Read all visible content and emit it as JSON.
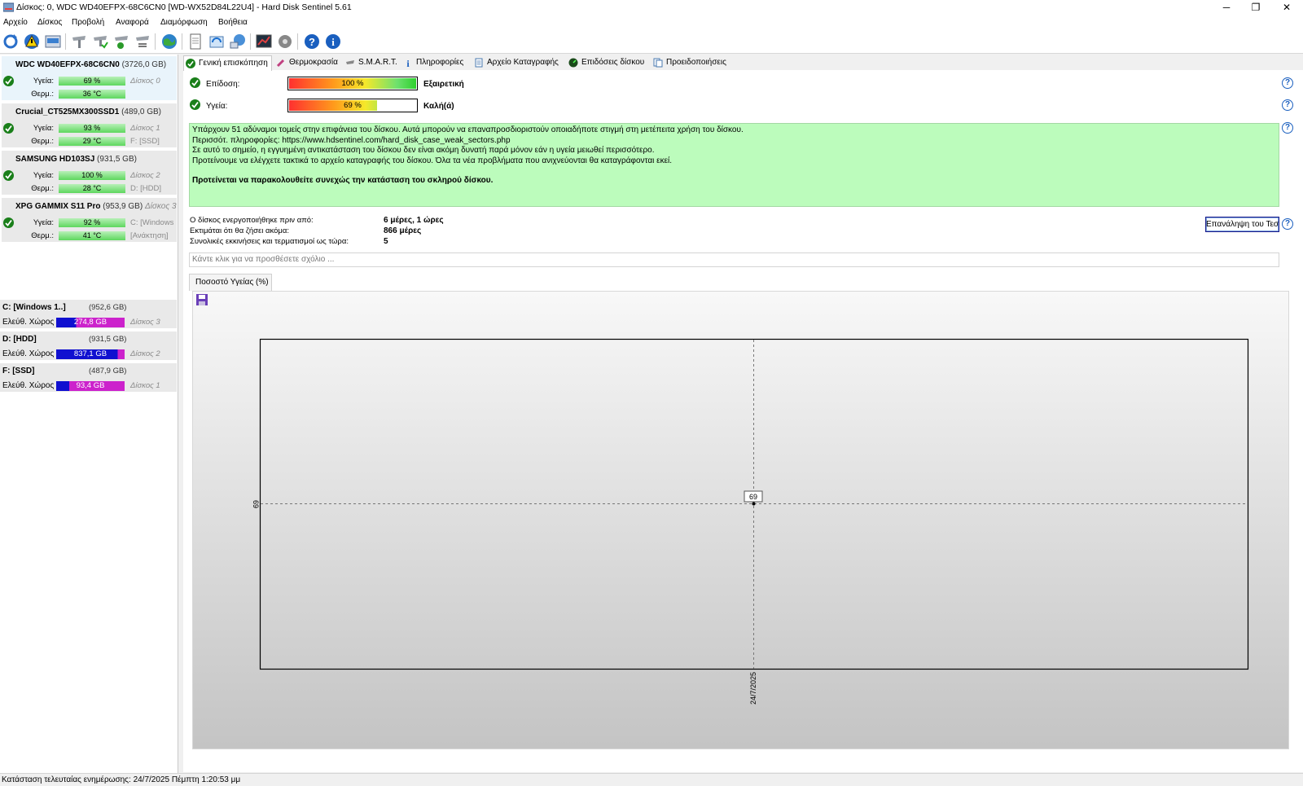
{
  "window": {
    "title": "Δίσκος: 0, WDC WD40EFPX-68C6CN0 [WD-WX52D84L22U4]  -  Hard Disk Sentinel 5.61",
    "minimize": "─",
    "maximize": "❐",
    "close": "✕"
  },
  "menu": [
    "Αρχείο",
    "Δίσκος",
    "Προβολή",
    "Αναφορά",
    "Διαμόρφωση",
    "Βοήθεια"
  ],
  "disks": [
    {
      "name": "WDC WD40EFPX-68C6CN0",
      "size": "(3726,0 GB)",
      "health_label": "Υγεία:",
      "health": "69 %",
      "temp_label": "Θερμ.:",
      "temp": "36 °C",
      "disk_no": "Δίσκος 0",
      "volume": ""
    },
    {
      "name": "Crucial_CT525MX300SSD1",
      "size": "(489,0 GB)",
      "health_label": "Υγεία:",
      "health": "93 %",
      "temp_label": "Θερμ.:",
      "temp": "29 °C",
      "disk_no": "Δίσκος 1",
      "volume": "F: [SSD]"
    },
    {
      "name": "SAMSUNG HD103SJ",
      "size": "(931,5 GB)",
      "health_label": "Υγεία:",
      "health": "100 %",
      "temp_label": "Θερμ.:",
      "temp": "28 °C",
      "disk_no": "Δίσκος 2",
      "volume": "D: [HDD]"
    },
    {
      "name": "XPG GAMMIX S11 Pro",
      "size": "(953,9 GB)",
      "health_label": "Υγεία:",
      "health": "92 %",
      "temp_label": "Θερμ.:",
      "temp": "41 °C",
      "disk_no": "Δίσκος 3",
      "volume": "C: [Windows",
      "volume2": "[Ανάκτηση]"
    }
  ],
  "volumes": [
    {
      "name": "C: [Windows 1..]",
      "size": "(952,6 GB)",
      "free_label": "Ελεύθ. Χώρος",
      "free": "274,8 GB",
      "free_fraction": 0.29,
      "disk": "Δίσκος 3"
    },
    {
      "name": "D: [HDD]",
      "size": "(931,5 GB)",
      "free_label": "Ελεύθ. Χώρος",
      "free": "837,1 GB",
      "free_fraction": 0.9,
      "disk": "Δίσκος 2"
    },
    {
      "name": "F: [SSD]",
      "size": "(487,9 GB)",
      "free_label": "Ελεύθ. Χώρος",
      "free": "93,4 GB",
      "free_fraction": 0.19,
      "disk": "Δίσκος 1"
    }
  ],
  "tabs": [
    "Γενική επισκόπηση",
    "Θερμοκρασία",
    "S.M.A.R.T.",
    "Πληροφορίες",
    "Αρχείο Καταγραφής",
    "Επιδόσεις δίσκου",
    "Προειδοποιήσεις"
  ],
  "overview": {
    "performance_label": "Επίδοση:",
    "performance_value": "100 %",
    "performance_fraction": 1.0,
    "performance_rating": "Εξαιρετική",
    "health_label": "Υγεία:",
    "health_value": "69 %",
    "health_fraction": 0.69,
    "health_rating": "Καλή(ά)",
    "message": [
      "Υπάρχουν 51 αδύναμοι τομείς στην επιφάνεια του δίσκου. Αυτά μπορούν να επαναπροσδιοριστούν οποιαδήποτε στιγμή στη μετέπειτα χρήση του δίσκου.",
      "Περισσότ. πληροφορίες:  https://www.hdsentinel.com/hard_disk_case_weak_sectors.php",
      "Σε αυτό το σημείο, η εγγυημένη αντικατάσταση του δίσκου δεν είναι ακόμη δυνατή παρά μόνον εάν η υγεία μειωθεί περισσότερο.",
      "Προτείνουμε να ελέγχετε τακτικά το αρχείο καταγραφής του δίσκου. Όλα τα νέα προβλήματα που ανιχνεύονται θα καταγράφονται εκεί."
    ],
    "message_bold": "Προτείνεται να παρακολουθείτε συνεχώς την κατάσταση του σκληρού δίσκου.",
    "powered_on_label": "Ο δίσκος ενεργοποιήθηκε πριν από:",
    "powered_on_value": "6 μέρες, 1 ώρες",
    "remaining_label": "Εκτιμάται ότι θα ζήσει ακόμα:",
    "remaining_value": "866 μέρες",
    "starts_label": "Συνολικές εκκινήσεις και τερματισμοί ως τώρα:",
    "starts_value": "5",
    "retest_button": "Επανάληψη του Τεστ",
    "comment_placeholder": "Κάντε κλικ για να προσθέσετε σχόλιο ..."
  },
  "chart_tab": "Ποσοστό Υγείας (%)",
  "chart_data": {
    "type": "line",
    "x": [
      "24/7/2025"
    ],
    "series": [
      {
        "values": [
          69
        ]
      }
    ],
    "data_labels": [
      "69"
    ],
    "ytick_labels": [
      "69"
    ],
    "xtick_labels": [
      "24/7/2025"
    ],
    "grid": true
  },
  "status": "Κατάσταση τελευταίας ενημέρωσης: 24/7/2025 Πέμπτη 1:20:53 μμ",
  "colors": {
    "health_green": "#5ed75e",
    "message_bg": "#bcfcbc",
    "volume_used": "#cc22cc",
    "volume_free": "#1010d0",
    "selected_disk_bg": "#e9f4fb"
  }
}
